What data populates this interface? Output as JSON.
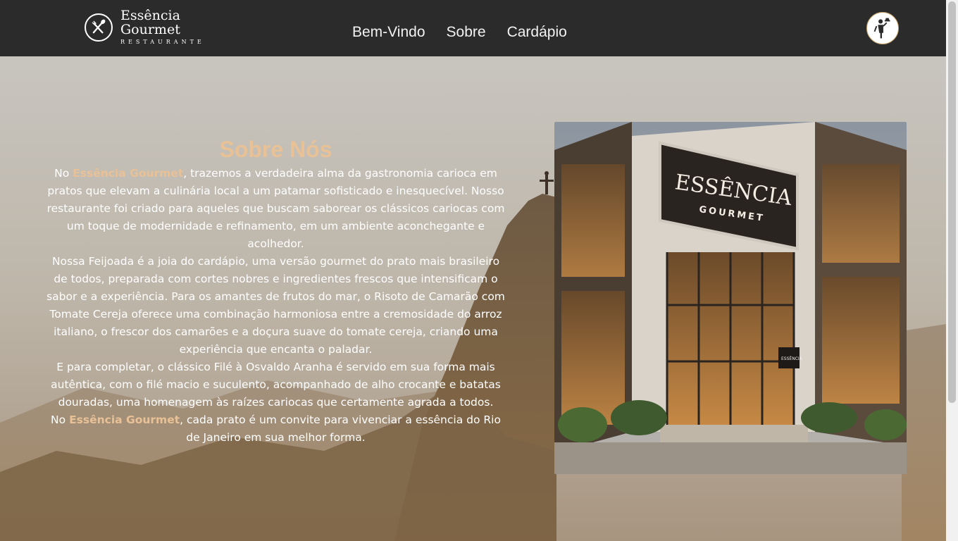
{
  "header": {
    "logo": {
      "line1": "Essência",
      "line2": "Gourmet",
      "tagline": "RESTAURANTE",
      "icon": "cutlery-emblem-icon"
    },
    "nav": [
      {
        "label": "Bem-Vindo"
      },
      {
        "label": "Sobre"
      },
      {
        "label": "Cardápio"
      }
    ],
    "action_icon": "waiter-icon"
  },
  "about": {
    "title": "Sobre Nós",
    "p1": {
      "prefix": "No ",
      "brand": "Essência Gourmet",
      "suffix": ", trazemos a verdadeira alma da gastronomia carioca em pratos que elevam a culinária local a um patamar sofisticado e inesquecível. Nosso restaurante foi criado para aqueles que buscam saborear os clássicos cariocas com um toque de modernidade e refinamento, em um ambiente aconchegante e acolhedor."
    },
    "p2": "Nossa Feijoada é a joia do cardápio, uma versão gourmet do prato mais brasileiro de todos, preparada com cortes nobres e ingredientes frescos que intensificam o sabor e a experiência. Para os amantes de frutos do mar, o Risoto de Camarão com Tomate Cereja oferece uma combinação harmoniosa entre a cremosidade do arroz italiano, o frescor dos camarões e a doçura suave do tomate cereja, criando uma experiência que encanta o paladar.",
    "p3": "E para completar, o clássico Filé à Osvaldo Aranha é servido em sua forma mais autêntica, com o filé macio e suculento, acompanhado de alho crocante e batatas douradas, uma homenagem às raízes cariocas que certamente agrada a todos.",
    "p4": {
      "prefix": "No ",
      "brand": "Essência Gourmet",
      "suffix": ", cada prato é um convite para vivenciar a essência do Rio de Janeiro em sua melhor forma."
    }
  },
  "photo": {
    "sign_line1": "ESSÊNCIA",
    "sign_line2": "GOURMET",
    "small_sign": "ESSÊNCIA"
  },
  "colors": {
    "header_bg": "#2b2b2b",
    "accent": "#e9c196",
    "text": "#ffffff"
  }
}
